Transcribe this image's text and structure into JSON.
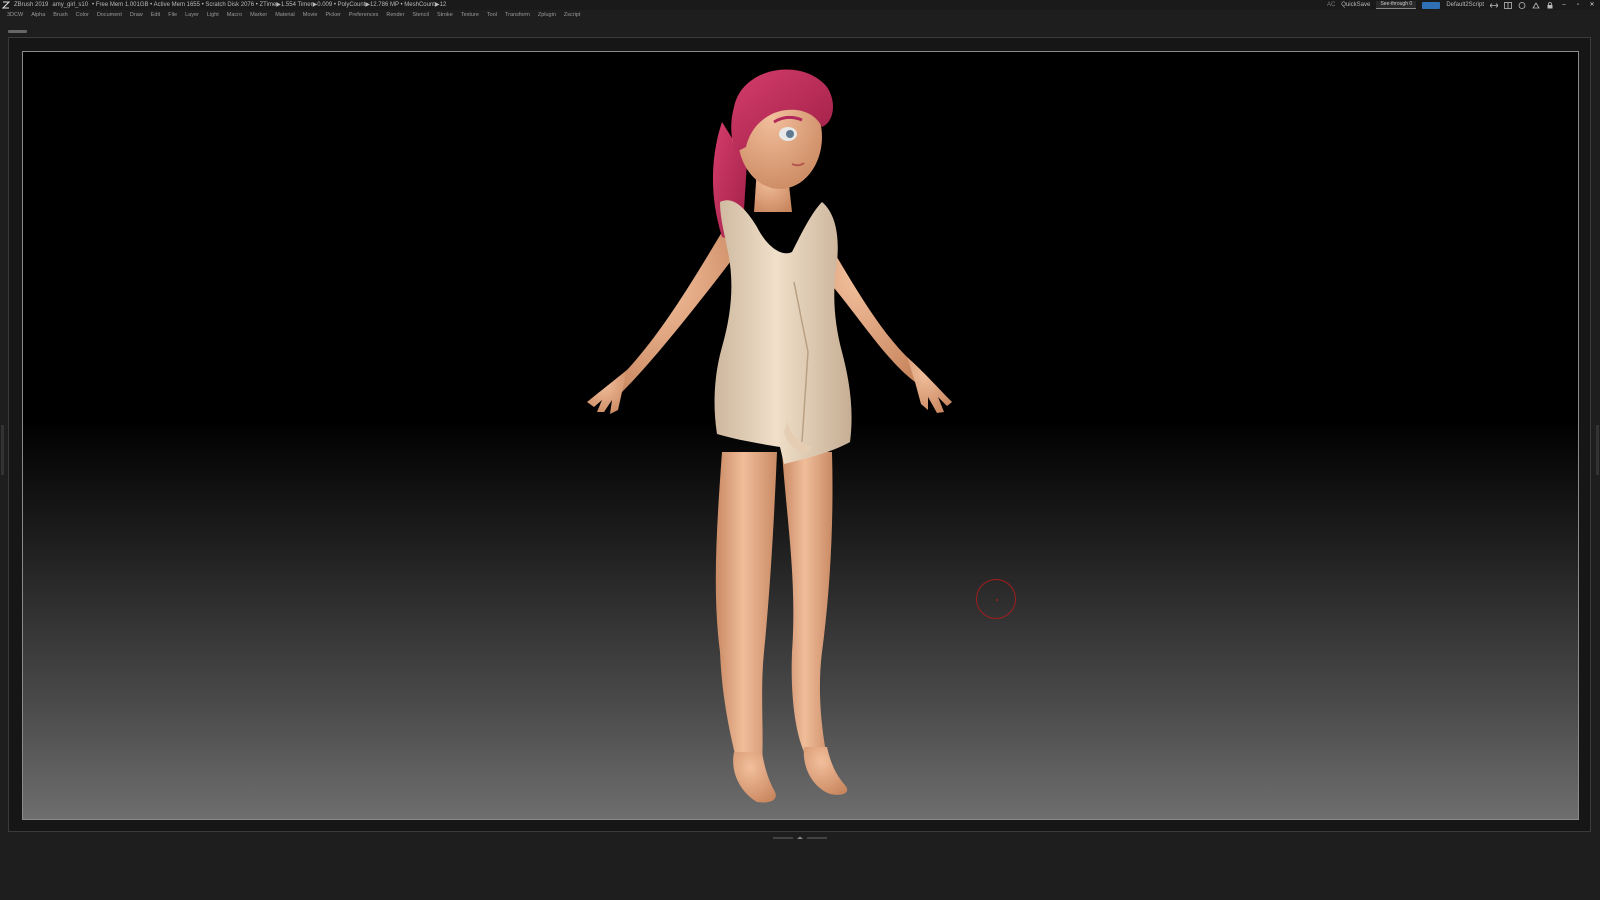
{
  "titlebar": {
    "app": "ZBrush 2019",
    "file": "amy_girl_s10",
    "status": "• Free Mem 1.001GB • Active Mem 1655 • Scratch Disk 2076 • ZTime▶1.554 Timer▶0.009 • PolyCount▶12.786 MP • MeshCount▶12",
    "ac": "AC",
    "quicksave": "QuickSave",
    "see_through": "See-through 0",
    "script": "Default2Script"
  },
  "menu": [
    "3DCW",
    "Alpha",
    "Brush",
    "Color",
    "Document",
    "Draw",
    "Edit",
    "File",
    "Layer",
    "Light",
    "Macro",
    "Marker",
    "Material",
    "Movie",
    "Picker",
    "Preferences",
    "Render",
    "Stencil",
    "Stroke",
    "Texture",
    "Tool",
    "Transform",
    "Zplugin",
    "Zscript"
  ],
  "icons": {
    "app_logo": "zbrush-logo-icon",
    "minimize": "minimize-icon",
    "restore": "restore-icon",
    "close": "close-icon",
    "brush_cursor": "brush-cursor-icon"
  },
  "colors": {
    "accent": "#2f6fb3",
    "brush_cursor": "#a21e1e",
    "hair": "#c8305e",
    "skin": "#e8a880",
    "dress": "#e7d3bb"
  }
}
